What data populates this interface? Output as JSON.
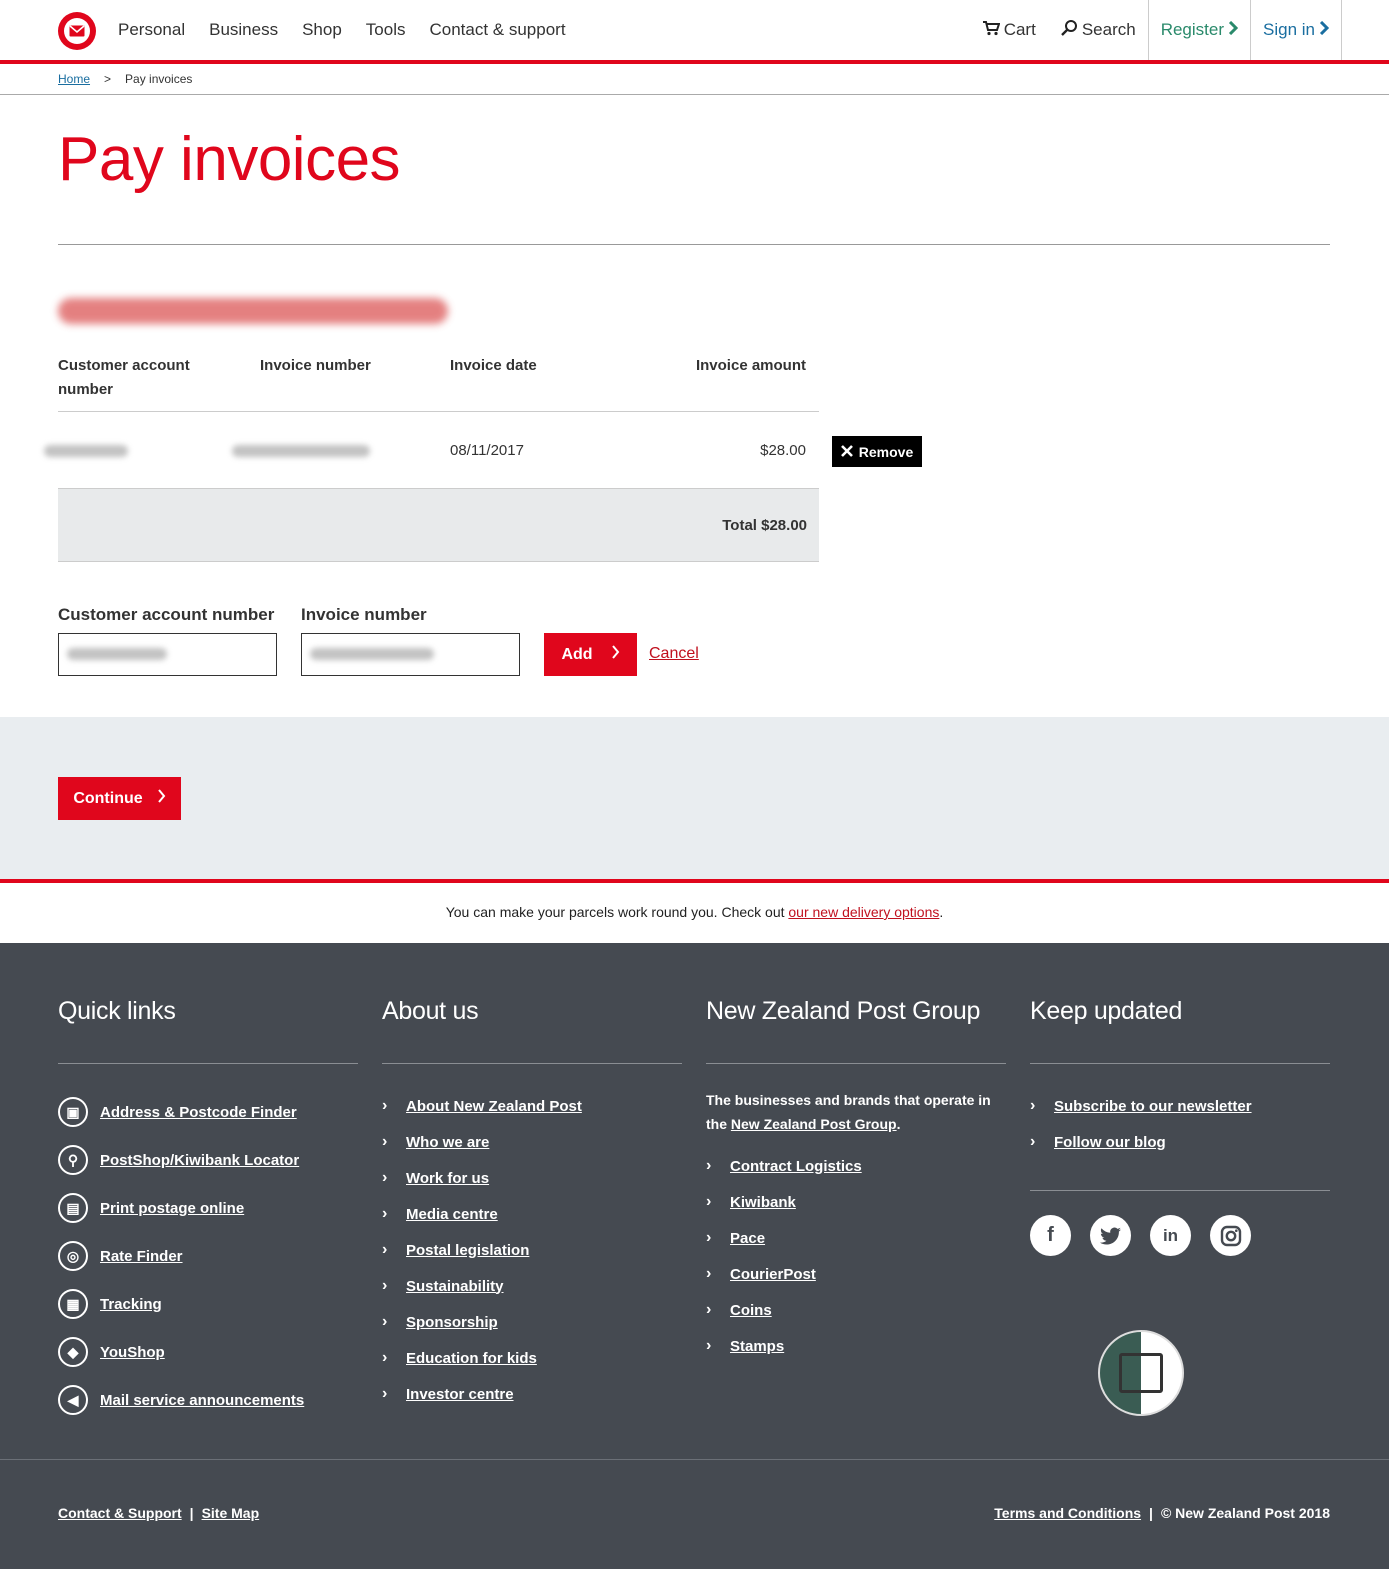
{
  "header": {
    "nav": [
      "Personal",
      "Business",
      "Shop",
      "Tools",
      "Contact & support"
    ],
    "cart": "Cart",
    "search": "Search",
    "register": "Register",
    "signin": "Sign in"
  },
  "breadcrumb": {
    "home": "Home",
    "separator": ">",
    "current": "Pay invoices"
  },
  "page": {
    "title": "Pay invoices"
  },
  "table": {
    "headers": {
      "account": "Customer account number",
      "invoice_number": "Invoice number",
      "invoice_date": "Invoice date",
      "invoice_amount": "Invoice amount"
    },
    "rows": [
      {
        "invoice_date": "08/11/2017",
        "invoice_amount": "$28.00",
        "remove_label": "Remove"
      }
    ],
    "total": "Total $28.00"
  },
  "form": {
    "account_label": "Customer account number",
    "invoice_label": "Invoice number",
    "add_label": "Add",
    "cancel_label": "Cancel"
  },
  "continue_label": "Continue",
  "notice": {
    "text": "You can make your parcels work round you. Check out ",
    "link": "our new delivery options",
    "end": "."
  },
  "footer": {
    "quick_links": {
      "title": "Quick links",
      "items": [
        {
          "label": "Address & Postcode Finder",
          "icon": "address-finder-icon"
        },
        {
          "label": "PostShop/Kiwibank Locator",
          "icon": "locator-icon"
        },
        {
          "label": "Print postage online",
          "icon": "print-icon"
        },
        {
          "label": "Rate Finder",
          "icon": "rate-finder-icon"
        },
        {
          "label": "Tracking",
          "icon": "tracking-icon"
        },
        {
          "label": "YouShop",
          "icon": "tag-icon"
        },
        {
          "label": "Mail service announcements",
          "icon": "megaphone-icon"
        }
      ]
    },
    "about": {
      "title": "About us",
      "items": [
        "About New Zealand Post",
        "Who we are",
        "Work for us",
        "Media centre",
        "Postal legislation",
        "Sustainability",
        "Sponsorship",
        "Education for kids",
        "Investor centre"
      ]
    },
    "group": {
      "title": "New Zealand Post Group",
      "intro": "The businesses and brands that operate in the ",
      "intro_link": "New Zealand Post Group",
      "intro_end": ".",
      "items": [
        "Contract Logistics",
        "Kiwibank",
        "Pace",
        "CourierPost",
        "Coins",
        "Stamps"
      ]
    },
    "updates": {
      "title": "Keep updated",
      "items": [
        "Subscribe to our newsletter",
        "Follow our blog"
      ],
      "social": [
        "facebook-icon",
        "twitter-icon",
        "linkedin-icon",
        "instagram-icon"
      ]
    },
    "bottom": {
      "contact": "Contact & Support",
      "sitemap": "Site Map",
      "terms": "Terms and Conditions",
      "copyright": "© New Zealand Post 2018",
      "divider": "|"
    }
  },
  "colors": {
    "brand_red": "#e0061c",
    "footer_bg": "#454a51",
    "register_green": "#2a8a6b",
    "signin_blue": "#1a6ea0"
  }
}
